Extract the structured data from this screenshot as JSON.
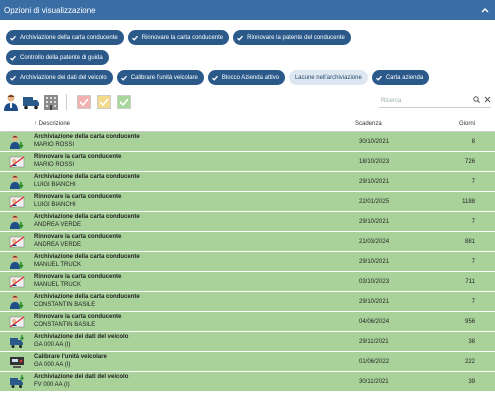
{
  "header": {
    "title": "Opzioni di visualizzazione"
  },
  "filters": {
    "row1": [
      {
        "label": "Archiviazione della carta conducente",
        "active": true
      },
      {
        "label": "Rinnovare la carta conducente",
        "active": true
      },
      {
        "label": "Rinnovare la patente del conducente",
        "active": true
      }
    ],
    "row2": [
      {
        "label": "Controllo della patente di guida",
        "active": true
      }
    ],
    "row3": [
      {
        "label": "Archiviazione dei dati del veicolo",
        "active": true
      },
      {
        "label": "Calibrare l'unità veicolare",
        "active": true
      },
      {
        "label": "Blocco Azienda attivo",
        "active": true
      },
      {
        "label": "Lacune nell'archiviazione",
        "active": false
      },
      {
        "label": "Carta azienda",
        "active": true
      }
    ]
  },
  "toolbar": {
    "icons": [
      "driver-icon",
      "truck-icon",
      "building-icon"
    ],
    "check_colors": [
      "#f3b1b1",
      "#f3d98a",
      "#a7d69a"
    ],
    "search_placeholder": "Ricerca"
  },
  "table": {
    "columns": {
      "desc": "Descrizione",
      "date": "Scadenza",
      "days": "Giorni"
    },
    "rows": [
      {
        "type": "driver-archive",
        "title": "Archiviazione della carta conducente",
        "name": "MARIO ROSSI",
        "date": "30/10/2021",
        "days": "8"
      },
      {
        "type": "card-renew",
        "title": "Rinnovare la carta conducente",
        "name": "MARIO ROSSI",
        "date": "18/10/2023",
        "days": "726"
      },
      {
        "type": "driver-archive",
        "title": "Archiviazione della carta conducente",
        "name": "LUIGI BIANCHI",
        "date": "29/10/2021",
        "days": "7"
      },
      {
        "type": "card-renew",
        "title": "Rinnovare la carta conducente",
        "name": "LUIGI BIANCHI",
        "date": "22/01/2025",
        "days": "1188"
      },
      {
        "type": "driver-archive",
        "title": "Archiviazione della carta conducente",
        "name": "ANDREA VERDE",
        "date": "29/10/2021",
        "days": "7"
      },
      {
        "type": "card-renew",
        "title": "Rinnovare la carta conducente",
        "name": "ANDREA VERDE",
        "date": "21/03/2024",
        "days": "881"
      },
      {
        "type": "driver-archive",
        "title": "Archiviazione della carta conducente",
        "name": "MANUEL TRUCK",
        "date": "29/10/2021",
        "days": "7"
      },
      {
        "type": "card-renew",
        "title": "Rinnovare la carta conducente",
        "name": "MANUEL TRUCK",
        "date": "03/10/2023",
        "days": "711"
      },
      {
        "type": "driver-archive",
        "title": "Archiviazione della carta conducente",
        "name": "CONSTANTIN BASILE",
        "date": "29/10/2021",
        "days": "7"
      },
      {
        "type": "card-renew",
        "title": "Rinnovare la carta conducente",
        "name": "CONSTANTIN BASILE",
        "date": "04/06/2024",
        "days": "956"
      },
      {
        "type": "vehicle-archive",
        "title": "Archiviazione dei dati del veicolo",
        "name": "GA 000 AA (I)",
        "date": "29/11/2021",
        "days": "38"
      },
      {
        "type": "calibrate",
        "title": "Calibrare l'unità veicolare",
        "name": "GA 000 AA (I)",
        "date": "01/06/2022",
        "days": "222"
      },
      {
        "type": "vehicle-archive",
        "title": "Archiviazione dei dati del veicolo",
        "name": "FV 000 AA (I)",
        "date": "30/11/2021",
        "days": "39"
      }
    ]
  },
  "colors": {
    "header": "#3a6ea5",
    "chip": "#2b5a8a",
    "row": "#a9d29b"
  }
}
